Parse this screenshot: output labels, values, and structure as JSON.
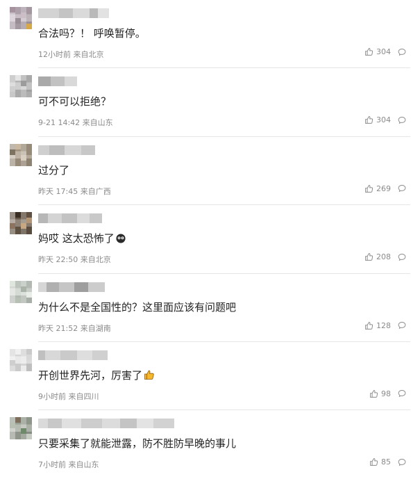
{
  "comments": [
    {
      "text": "合法吗？！ 呼唤暂停。",
      "meta": "12小时前 来自北京",
      "likes": "304",
      "emoji": ""
    },
    {
      "text": "可不可以拒绝？",
      "meta": "9-21 14:42 来自山东",
      "likes": "304",
      "emoji": ""
    },
    {
      "text": "过分了",
      "meta": "昨天 17:45 来自广西",
      "likes": "269",
      "emoji": ""
    },
    {
      "text": "妈哎 这太恐怖了",
      "meta": "昨天 22:50 来自北京",
      "likes": "208",
      "emoji": "shocked-face-icon"
    },
    {
      "text": "为什么不是全国性的？这里面应该有问题吧",
      "meta": "昨天 21:52 来自湖南",
      "likes": "128",
      "emoji": ""
    },
    {
      "text": "开创世界先河，厉害了",
      "meta": "9小时前 来自四川",
      "likes": "98",
      "emoji": "thumbs-up-emoji-icon"
    },
    {
      "text": "只要采集了就能泄露，防不胜防早晚的事儿",
      "meta": "7小时前 来自山东",
      "likes": "85",
      "emoji": ""
    }
  ],
  "icons": {
    "like": "thumb-up-outline-icon",
    "reply": "comment-bubble-icon"
  },
  "colors": {
    "meta_text": "#8a8a8a",
    "divider": "#e6e6e6"
  }
}
